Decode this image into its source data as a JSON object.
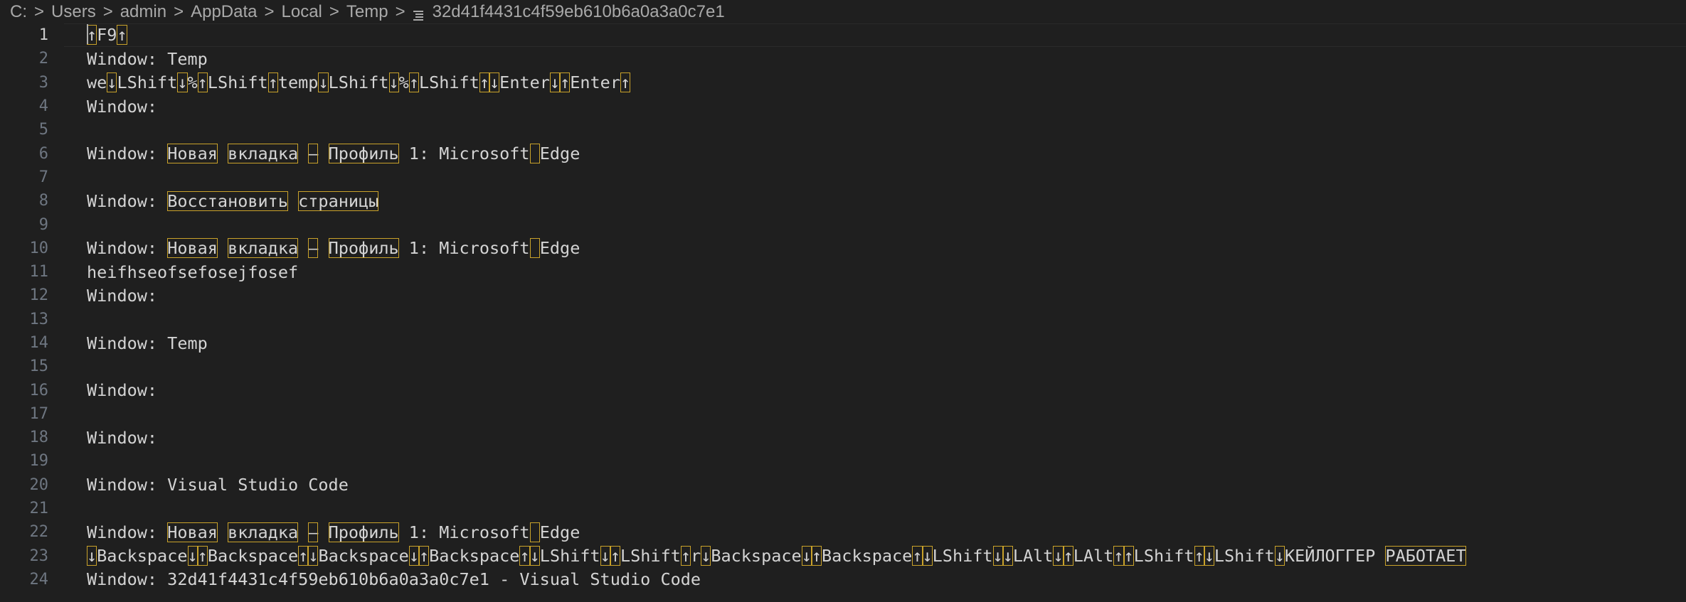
{
  "breadcrumb": {
    "items": [
      "C:",
      "Users",
      "admin",
      "AppData",
      "Local",
      "Temp"
    ],
    "file": "32d41f4431c4f59eb610b6a0a3a0c7e1",
    "separator": ">"
  },
  "active_line": 1,
  "lines": [
    [
      [
        "u",
        "↑"
      ],
      [
        "t",
        "F9"
      ],
      [
        "u",
        "↑"
      ]
    ],
    [
      [
        "t",
        "Window: Temp"
      ]
    ],
    [
      [
        "t",
        "we"
      ],
      [
        "u",
        "↓"
      ],
      [
        "t",
        "LShift"
      ],
      [
        "u",
        "↓"
      ],
      [
        "t",
        "%"
      ],
      [
        "u",
        "↑"
      ],
      [
        "t",
        "LShift"
      ],
      [
        "u",
        "↑"
      ],
      [
        "t",
        "temp"
      ],
      [
        "u",
        "↓"
      ],
      [
        "t",
        "LShift"
      ],
      [
        "u",
        "↓"
      ],
      [
        "t",
        "%"
      ],
      [
        "u",
        "↑"
      ],
      [
        "t",
        "LShift"
      ],
      [
        "u",
        "↑"
      ],
      [
        "u",
        "↓"
      ],
      [
        "t",
        "Enter"
      ],
      [
        "u",
        "↓"
      ],
      [
        "u",
        "↑"
      ],
      [
        "t",
        "Enter"
      ],
      [
        "u",
        "↑"
      ]
    ],
    [
      [
        "t",
        "Window:"
      ]
    ],
    [],
    [
      [
        "t",
        "Window: "
      ],
      [
        "u",
        "Новая"
      ],
      [
        "t",
        " "
      ],
      [
        "u",
        "вкладка"
      ],
      [
        "t",
        " "
      ],
      [
        "u",
        "—"
      ],
      [
        "t",
        " "
      ],
      [
        "u",
        "Профиль"
      ],
      [
        "t",
        " 1: Microsoft"
      ],
      [
        "u",
        " "
      ],
      [
        "t",
        "Edge"
      ]
    ],
    [],
    [
      [
        "t",
        "Window: "
      ],
      [
        "u",
        "Восстановить"
      ],
      [
        "t",
        " "
      ],
      [
        "u",
        "страницы"
      ]
    ],
    [],
    [
      [
        "t",
        "Window: "
      ],
      [
        "u",
        "Новая"
      ],
      [
        "t",
        " "
      ],
      [
        "u",
        "вкладка"
      ],
      [
        "t",
        " "
      ],
      [
        "u",
        "—"
      ],
      [
        "t",
        " "
      ],
      [
        "u",
        "Профиль"
      ],
      [
        "t",
        " 1: Microsoft"
      ],
      [
        "u",
        " "
      ],
      [
        "t",
        "Edge"
      ]
    ],
    [
      [
        "t",
        "heifhseofsefosejfosef"
      ]
    ],
    [
      [
        "t",
        "Window:"
      ]
    ],
    [],
    [
      [
        "t",
        "Window: Temp"
      ]
    ],
    [],
    [
      [
        "t",
        "Window:"
      ]
    ],
    [],
    [
      [
        "t",
        "Window:"
      ]
    ],
    [],
    [
      [
        "t",
        "Window: Visual Studio Code"
      ]
    ],
    [],
    [
      [
        "t",
        "Window: "
      ],
      [
        "u",
        "Новая"
      ],
      [
        "t",
        " "
      ],
      [
        "u",
        "вкладка"
      ],
      [
        "t",
        " "
      ],
      [
        "u",
        "—"
      ],
      [
        "t",
        " "
      ],
      [
        "u",
        "Профиль"
      ],
      [
        "t",
        " 1: Microsoft"
      ],
      [
        "u",
        " "
      ],
      [
        "t",
        "Edge"
      ]
    ],
    [
      [
        "u",
        "↓"
      ],
      [
        "t",
        "Backspace"
      ],
      [
        "u",
        "↓"
      ],
      [
        "u",
        "↑"
      ],
      [
        "t",
        "Backspace"
      ],
      [
        "u",
        "↑"
      ],
      [
        "u",
        "↓"
      ],
      [
        "t",
        "Backspace"
      ],
      [
        "u",
        "↓"
      ],
      [
        "u",
        "↑"
      ],
      [
        "t",
        "Backspace"
      ],
      [
        "u",
        "↑"
      ],
      [
        "u",
        "↓"
      ],
      [
        "t",
        "LShift"
      ],
      [
        "u",
        "↓"
      ],
      [
        "u",
        "↑"
      ],
      [
        "t",
        "LShift"
      ],
      [
        "u",
        "↑"
      ],
      [
        "t",
        "r"
      ],
      [
        "u",
        "↓"
      ],
      [
        "t",
        "Backspace"
      ],
      [
        "u",
        "↓"
      ],
      [
        "u",
        "↑"
      ],
      [
        "t",
        "Backspace"
      ],
      [
        "u",
        "↑"
      ],
      [
        "u",
        "↓"
      ],
      [
        "t",
        "LShift"
      ],
      [
        "u",
        "↓"
      ],
      [
        "u",
        "↓"
      ],
      [
        "t",
        "LAlt"
      ],
      [
        "u",
        "↓"
      ],
      [
        "u",
        "↑"
      ],
      [
        "t",
        "LAlt"
      ],
      [
        "u",
        "↑"
      ],
      [
        "u",
        "↑"
      ],
      [
        "t",
        "LShift"
      ],
      [
        "u",
        "↑"
      ],
      [
        "u",
        "↓"
      ],
      [
        "t",
        "LShift"
      ],
      [
        "u",
        "↓"
      ],
      [
        "t",
        "КЕЙЛОГГЕР"
      ],
      [
        "t",
        " "
      ],
      [
        "u",
        "РАБОТАЕТ"
      ]
    ],
    [
      [
        "t",
        "Window: 32d41f4431c4f59eb610b6a0a3a0c7e1 - Visual Studio Code"
      ]
    ]
  ]
}
